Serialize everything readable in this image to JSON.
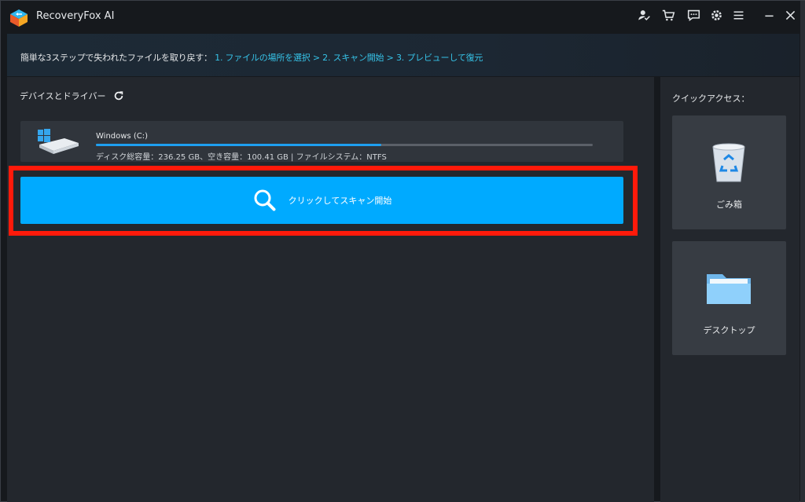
{
  "app": {
    "title": "RecoveryFox AI"
  },
  "titlebar": {
    "icons": [
      "account-check-icon",
      "cart-icon",
      "feedback-icon",
      "settings-gear-icon",
      "menu-icon",
      "minimize-icon",
      "close-icon"
    ]
  },
  "banner": {
    "lead": "簡単な3ステップで失われたファイルを取り戻す：",
    "steps": "1. ファイルの場所を選択 > 2. スキャン開始 > 3. プレビューして復元"
  },
  "devices": {
    "title": "デバイスとドライバー",
    "drive": {
      "name": "Windows (C:)",
      "info": "ディスク総容量：236.25 GB、空き容量：100.41 GB | ファイルシステム：NTFS",
      "used_fraction": 0.575
    },
    "scan_label": "クリックしてスキャン開始"
  },
  "quick_access": {
    "title": "クイックアクセス：",
    "items": [
      {
        "label": "ごみ箱",
        "icon": "recycle-bin-icon"
      },
      {
        "label": "デスクトップ",
        "icon": "folder-icon"
      }
    ]
  },
  "colors": {
    "accent": "#00aaff",
    "step_text": "#36c3e8",
    "highlight": "#ff1a0a",
    "progress": "#1e9ff0"
  }
}
